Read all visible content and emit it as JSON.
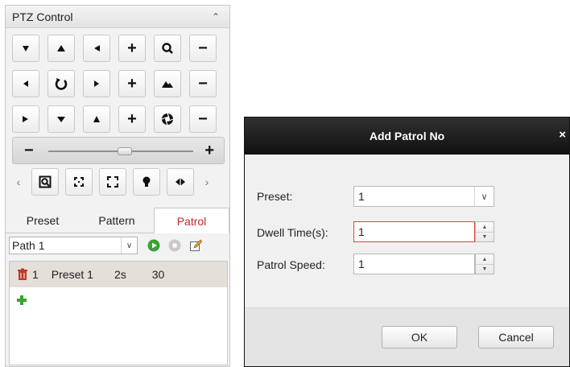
{
  "ptz": {
    "title": "PTZ Control",
    "collapse_icon": "chevron-up-icon",
    "grid": [
      [
        "arrow-up-left-icon",
        "arrow-up-icon",
        "arrow-up-right-icon",
        "zoom-plus-icon",
        "zoom-icon",
        "zoom-minus-icon"
      ],
      [
        "arrow-left-icon",
        "auto-rotate-icon",
        "arrow-right-icon",
        "focus-plus-icon",
        "focus-icon",
        "focus-minus-icon"
      ],
      [
        "arrow-down-left-icon",
        "arrow-down-icon",
        "arrow-down-right-icon",
        "iris-plus-icon",
        "iris-icon",
        "iris-minus-icon"
      ]
    ],
    "speed_slider": {
      "minus": "−",
      "plus": "+",
      "value_fraction": 0.55
    },
    "tools": [
      "3d-zoom-icon",
      "center-icon",
      "fullscreen-icon",
      "light-icon",
      "wiper-icon"
    ],
    "tabs": [
      {
        "label": "Preset",
        "active": false
      },
      {
        "label": "Pattern",
        "active": false
      },
      {
        "label": "Patrol",
        "active": true
      }
    ],
    "path": {
      "value": "Path 1"
    },
    "patrol_rows": [
      {
        "no": "1",
        "preset": "Preset 1",
        "dwell": "2s",
        "speed": "30"
      }
    ]
  },
  "dialog": {
    "title": "Add Patrol No",
    "close": "×",
    "preset_label": "Preset:",
    "preset_value": "1",
    "dwell_label": "Dwell Time(s):",
    "dwell_value": "1",
    "speed_label": "Patrol Speed:",
    "speed_value": "1",
    "ok": "OK",
    "cancel": "Cancel"
  },
  "colors": {
    "active_tab": "#c62828",
    "play_green": "#3aa334",
    "delete_red": "#c0392b",
    "dialog_header": "#1e1e1e",
    "row_highlight": "#e4dfd8"
  }
}
